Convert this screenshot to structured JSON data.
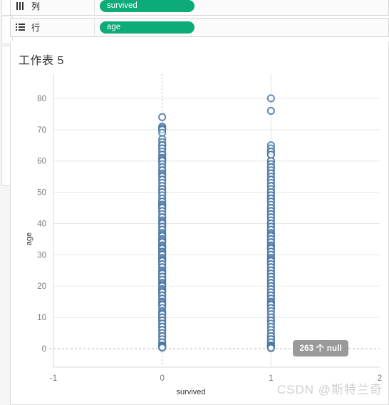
{
  "shelves": [
    {
      "id": "columns",
      "icon": "columns-icon",
      "label": "列",
      "pill": "survived"
    },
    {
      "id": "rows",
      "icon": "rows-icon",
      "label": "行",
      "pill": "age"
    }
  ],
  "worksheet": {
    "title": "工作表 5"
  },
  "null_badge": {
    "text": "263 个 null"
  },
  "watermark": {
    "text": "CSDN @斯特兰奇"
  },
  "colors": {
    "pill_green": "#0cab78",
    "marker_blue": "#4a77a8",
    "gridline": "#e8e8e8",
    "badge_gray": "#9a9a9a",
    "tick_text": "#777777"
  },
  "chart_data": {
    "type": "scatter",
    "title": "工作表 5",
    "xlabel": "survived",
    "ylabel": "age",
    "xlim": [
      -1,
      2
    ],
    "ylim": [
      0,
      85
    ],
    "xticks": [
      -1,
      0,
      1,
      2
    ],
    "yticks": [
      0,
      10,
      20,
      30,
      40,
      50,
      60,
      70,
      80
    ],
    "grid": true,
    "legend": false,
    "marker": "open-circle",
    "marker_color": "#4a77a8",
    "reference_lines": {
      "x_zero_dashed": 0,
      "x_one_solid": 1,
      "y_zero_dashed": 0
    },
    "null_count": 263,
    "series": [
      {
        "name": "survived = 0",
        "x": 0,
        "y": [
          74.0,
          71.0,
          70.5,
          70.0,
          70.0,
          69.0,
          67.0,
          66.0,
          65.0,
          65.0,
          65.0,
          64.0,
          64.0,
          63.0,
          62.0,
          62.0,
          61.0,
          61.0,
          60.5,
          60.0,
          60.0,
          59.0,
          58.0,
          57.0,
          57.0,
          56.0,
          55.5,
          55.0,
          54.0,
          54.0,
          53.0,
          52.0,
          51.0,
          51.0,
          50.0,
          50.0,
          49.0,
          48.0,
          47.0,
          47.0,
          46.0,
          46.0,
          45.5,
          45.0,
          45.0,
          44.0,
          44.0,
          43.0,
          42.0,
          42.0,
          41.0,
          40.5,
          40.0,
          40.0,
          39.0,
          39.0,
          38.0,
          38.0,
          37.0,
          36.5,
          36.0,
          36.0,
          35.0,
          35.0,
          34.5,
          34.0,
          34.0,
          33.0,
          33.0,
          32.5,
          32.0,
          32.0,
          31.0,
          31.0,
          30.5,
          30.0,
          30.0,
          29.0,
          29.0,
          28.5,
          28.0,
          28.0,
          27.0,
          27.0,
          26.0,
          26.0,
          25.0,
          25.0,
          24.5,
          24.0,
          24.0,
          23.0,
          23.0,
          22.0,
          22.0,
          21.0,
          21.0,
          20.5,
          20.0,
          20.0,
          19.0,
          19.0,
          18.5,
          18.0,
          18.0,
          17.0,
          17.0,
          16.0,
          16.0,
          15.0,
          15.0,
          14.5,
          14.0,
          14.0,
          13.0,
          12.0,
          11.5,
          11.0,
          11.0,
          10.0,
          10.0,
          9.0,
          9.0,
          8.0,
          8.0,
          7.0,
          7.0,
          6.0,
          6.0,
          5.0,
          4.0,
          4.0,
          3.0,
          2.0,
          2.0,
          1.0,
          1.0,
          0.83,
          0.75,
          0.67,
          0.42,
          0.33
        ]
      },
      {
        "name": "survived = 1",
        "x": 1,
        "y": [
          80.0,
          76.0,
          65.0,
          64.0,
          63.0,
          63.0,
          62.0,
          62.0,
          60.0,
          60.0,
          59.0,
          58.0,
          58.0,
          57.0,
          56.0,
          56.0,
          55.0,
          54.0,
          54.0,
          53.0,
          52.0,
          52.0,
          51.0,
          50.0,
          50.0,
          49.0,
          49.0,
          48.0,
          48.0,
          47.0,
          47.0,
          46.0,
          45.0,
          45.0,
          44.0,
          44.0,
          43.0,
          43.0,
          42.0,
          42.0,
          41.0,
          40.0,
          40.0,
          39.0,
          39.0,
          38.0,
          38.0,
          37.0,
          36.5,
          36.0,
          36.0,
          35.0,
          35.0,
          34.0,
          34.0,
          33.0,
          33.0,
          32.5,
          32.0,
          32.0,
          31.0,
          31.0,
          30.0,
          30.0,
          29.0,
          29.0,
          28.5,
          28.0,
          28.0,
          27.0,
          27.0,
          26.0,
          26.0,
          25.0,
          25.0,
          24.0,
          24.0,
          23.0,
          23.0,
          22.0,
          22.0,
          21.0,
          21.0,
          20.0,
          20.0,
          19.0,
          19.0,
          18.0,
          18.0,
          17.0,
          17.0,
          16.0,
          16.0,
          15.0,
          15.0,
          14.5,
          14.0,
          14.0,
          13.0,
          13.0,
          12.0,
          11.0,
          10.0,
          9.0,
          9.0,
          8.0,
          7.0,
          6.0,
          5.0,
          4.0,
          4.0,
          3.0,
          3.0,
          2.0,
          2.0,
          1.0,
          1.0,
          0.92,
          0.83,
          0.75,
          0.67,
          0.42,
          0.33,
          0.17
        ]
      }
    ]
  }
}
